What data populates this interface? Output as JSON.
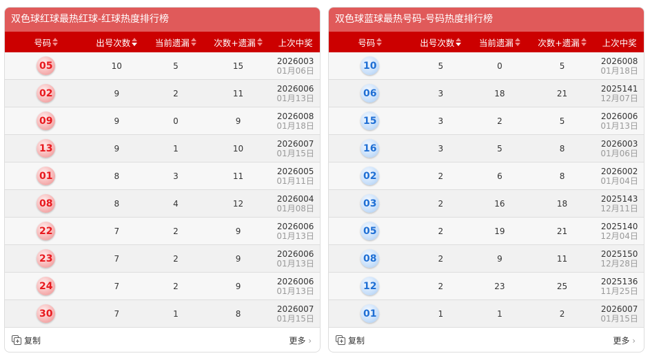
{
  "headers": [
    "号码",
    "出号次数",
    "当前遗漏",
    "次数+遗漏",
    "上次中奖"
  ],
  "copy_label": "复制",
  "more_label": "更多",
  "panels": [
    {
      "title": "双色球红球最热红球-红球热度排行榜",
      "ball": "red",
      "rows": [
        [
          "05",
          "10",
          "5",
          "15",
          "2026003",
          "01月06日"
        ],
        [
          "02",
          "9",
          "2",
          "11",
          "2026006",
          "01月13日"
        ],
        [
          "09",
          "9",
          "0",
          "9",
          "2026008",
          "01月18日"
        ],
        [
          "13",
          "9",
          "1",
          "10",
          "2026007",
          "01月15日"
        ],
        [
          "01",
          "8",
          "3",
          "11",
          "2026005",
          "01月11日"
        ],
        [
          "08",
          "8",
          "4",
          "12",
          "2026004",
          "01月08日"
        ],
        [
          "22",
          "7",
          "2",
          "9",
          "2026006",
          "01月13日"
        ],
        [
          "23",
          "7",
          "2",
          "9",
          "2026006",
          "01月13日"
        ],
        [
          "24",
          "7",
          "2",
          "9",
          "2026006",
          "01月13日"
        ],
        [
          "30",
          "7",
          "1",
          "8",
          "2026007",
          "01月15日"
        ]
      ]
    },
    {
      "title": "双色球蓝球最热号码-号码热度排行榜",
      "ball": "blue",
      "rows": [
        [
          "10",
          "5",
          "0",
          "5",
          "2026008",
          "01月18日"
        ],
        [
          "06",
          "3",
          "18",
          "21",
          "2025141",
          "12月07日"
        ],
        [
          "15",
          "3",
          "2",
          "5",
          "2026006",
          "01月13日"
        ],
        [
          "16",
          "3",
          "5",
          "8",
          "2026003",
          "01月06日"
        ],
        [
          "02",
          "2",
          "6",
          "8",
          "2026002",
          "01月04日"
        ],
        [
          "03",
          "2",
          "16",
          "18",
          "2025143",
          "12月11日"
        ],
        [
          "05",
          "2",
          "19",
          "21",
          "2025140",
          "12月04日"
        ],
        [
          "08",
          "2",
          "9",
          "11",
          "2025150",
          "12月28日"
        ],
        [
          "12",
          "2",
          "23",
          "25",
          "2025136",
          "11月25日"
        ],
        [
          "01",
          "1",
          "1",
          "2",
          "2026007",
          "01月15日"
        ]
      ]
    }
  ]
}
